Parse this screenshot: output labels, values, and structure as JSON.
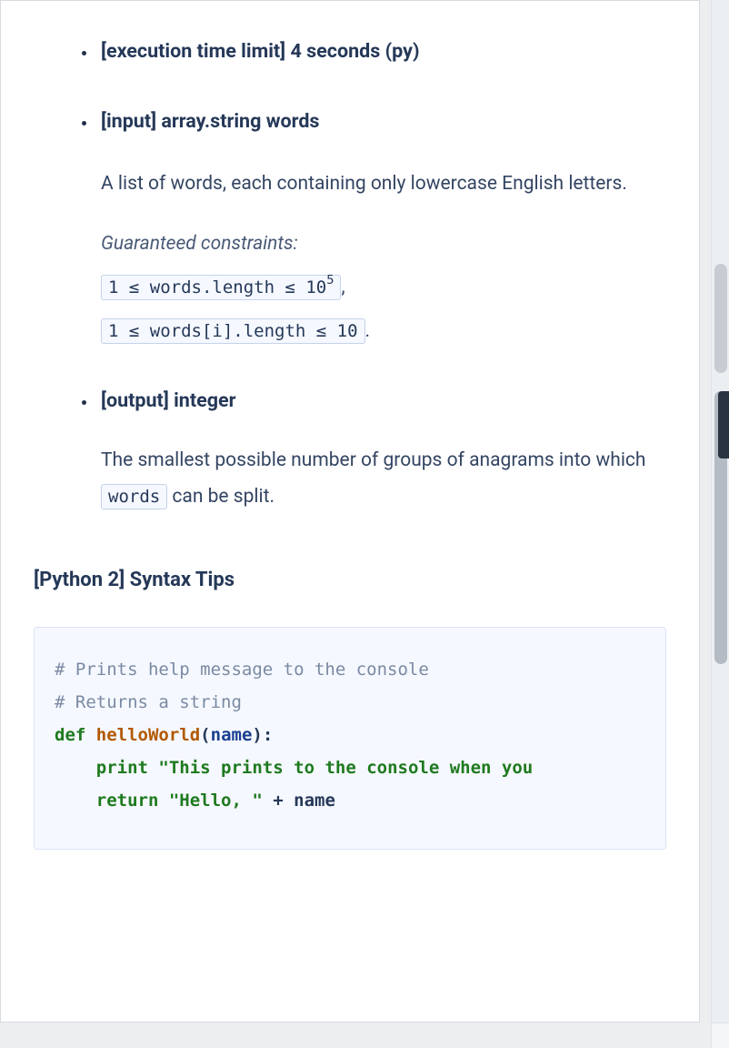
{
  "bullets": {
    "time_limit": {
      "label": "[execution time limit] 4 seconds (py)"
    },
    "input": {
      "label": "[input] array.string words",
      "description": "A list of words, each containing only lowercase English letters.",
      "constraints_label": "Guaranteed constraints:",
      "c1_pre": "1 ≤ words.length ≤ 10",
      "c1_sup": "5",
      "c1_after": ",",
      "c2": "1 ≤ words[i].length ≤ 10",
      "c2_after": "."
    },
    "output": {
      "label": "[output] integer",
      "desc_pre": "The smallest possible number of groups of anagrams into which ",
      "desc_code": "words",
      "desc_post": " can be split."
    }
  },
  "syntax_tips_heading": "[Python 2] Syntax Tips",
  "code": {
    "c1": "# Prints help message to the console",
    "c2": "# Returns a string",
    "kw_def": "def",
    "fn": "helloWorld",
    "lp": "(",
    "arg": "name",
    "rp_colon": "):",
    "kw_print": "print",
    "str1": "\"This prints to the console when you ",
    "kw_return": "return",
    "str2": "\"Hello, \"",
    "plus": " + ",
    "name2": "name"
  }
}
